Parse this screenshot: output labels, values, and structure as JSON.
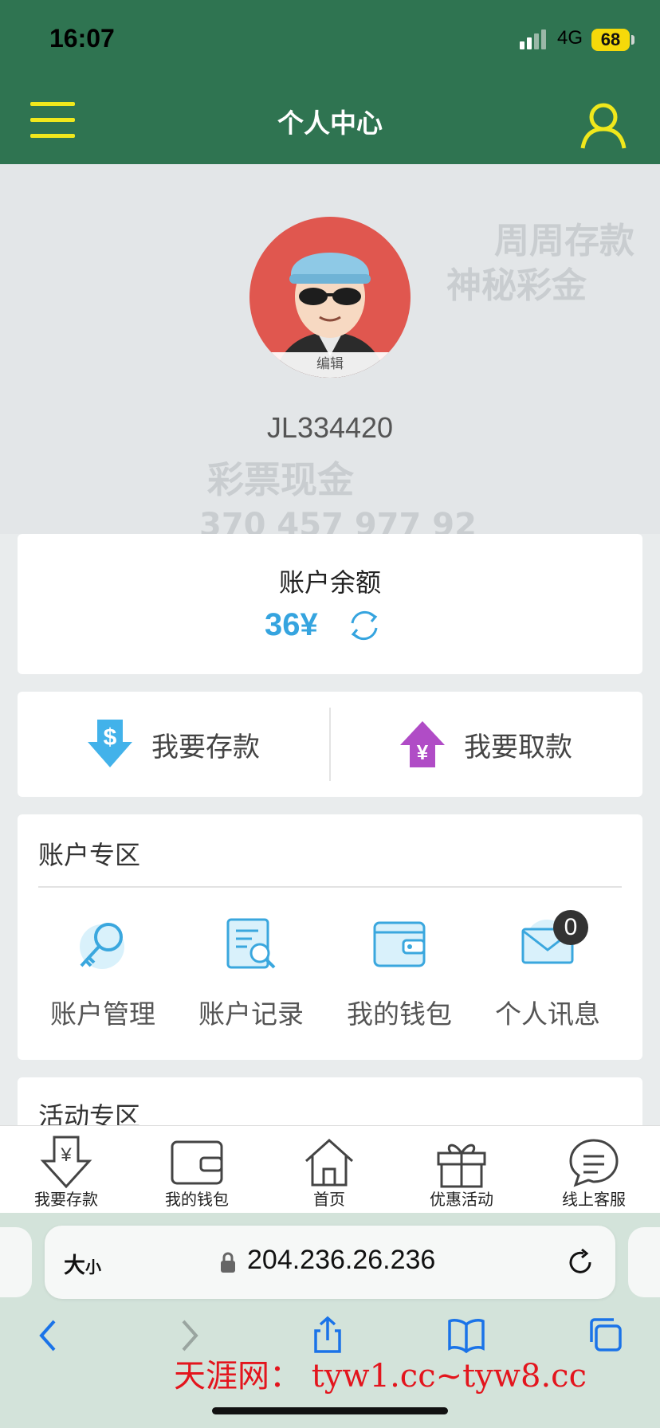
{
  "status_bar": {
    "time": "16:07",
    "network": "4G",
    "battery": "68"
  },
  "header": {
    "title": "个人中心"
  },
  "profile": {
    "avatar_edit": "编辑",
    "username": "JL334420"
  },
  "balance": {
    "label": "账户余额",
    "value": "36¥"
  },
  "actions": {
    "deposit": "我要存款",
    "withdraw": "我要取款"
  },
  "account_zone": {
    "title": "账户专区",
    "items": [
      {
        "label": "账户管理",
        "icon": "key-icon"
      },
      {
        "label": "账户记录",
        "icon": "record-search-icon"
      },
      {
        "label": "我的钱包",
        "icon": "wallet-icon"
      },
      {
        "label": "个人讯息",
        "icon": "mail-icon"
      }
    ],
    "message_count": "0"
  },
  "activity_zone": {
    "title": "活动专区"
  },
  "tabbar": [
    {
      "label": "我要存款",
      "icon": "deposit-icon"
    },
    {
      "label": "我的钱包",
      "icon": "wallet-icon"
    },
    {
      "label": "首页",
      "icon": "home-icon"
    },
    {
      "label": "优惠活动",
      "icon": "gift-icon"
    },
    {
      "label": "线上客服",
      "icon": "chat-icon"
    }
  ],
  "browser": {
    "text_size_big": "大",
    "text_size_small": "小",
    "url": "204.236.26.236"
  },
  "watermark": "天涯网： tyw1.cc~tyw8.cc",
  "colors": {
    "header": "#2f7451",
    "accent_yellow": "#f0e81c",
    "balance_blue": "#35a4df"
  }
}
